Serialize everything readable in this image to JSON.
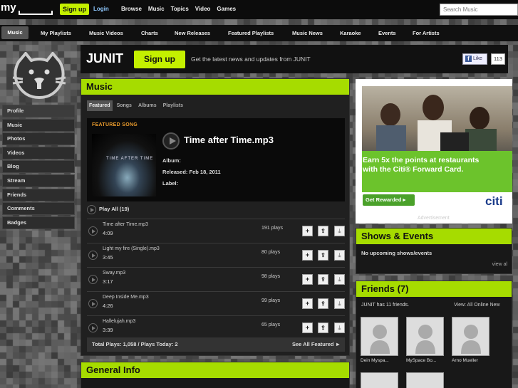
{
  "topbar": {
    "logo_text": "my",
    "signup_label": "Sign up",
    "login_label": "Login",
    "nav": [
      "Browse",
      "Music",
      "Topics",
      "Video",
      "Games"
    ],
    "search_placeholder": "Search Music"
  },
  "subnav": {
    "items": [
      "Music",
      "My Playlists",
      "Music Videos",
      "Charts",
      "New Releases",
      "Featured Playlists",
      "Music News",
      "Karaoke",
      "Events",
      "For Artists"
    ]
  },
  "sidebar": {
    "items": [
      "Profile",
      "Music",
      "Photos",
      "Videos",
      "Blog",
      "Stream",
      "Friends",
      "Comments",
      "Badges"
    ]
  },
  "header": {
    "artist_name": "JUNIT",
    "signup_label": "Sign up",
    "tagline": "Get the latest news and updates from JUNIT",
    "like_label": "Like",
    "like_count": "113"
  },
  "music": {
    "title": "Music",
    "tabs": [
      "Featured",
      "Songs",
      "Albums",
      "Playlists"
    ],
    "featured": {
      "label": "FEATURED SONG",
      "art_text": "TIME AFTER TIME",
      "song_title": "Time after Time.mp3",
      "album_label": "Album:",
      "released_label": "Released: Feb 18, 2011",
      "label_label": "Label:"
    },
    "play_all": "Play All (19)",
    "songs": [
      {
        "name": "Time after Time.mp3",
        "duration": "4:09",
        "plays": "191 plays"
      },
      {
        "name": "Light my fire (Single).mp3",
        "duration": "3:45",
        "plays": "80 plays"
      },
      {
        "name": "Sway.mp3",
        "duration": "3:17",
        "plays": "98 plays"
      },
      {
        "name": "Deep Inside Me.mp3",
        "duration": "4:26",
        "plays": "99 plays"
      },
      {
        "name": "Hallelujah.mp3",
        "duration": "3:39",
        "plays": "65 plays"
      }
    ],
    "totals": "Total Plays: 1,058 / Plays Today: 2",
    "see_all": "See All Featured ►"
  },
  "general_info": {
    "title": "General Info"
  },
  "ad": {
    "headline_1": "Earn 5x the points at restaurants",
    "headline_2": "with the Citi® Forward Card.",
    "cta": "Get Rewarded ▸",
    "brand": "citi",
    "caption": "Advertisement"
  },
  "shows": {
    "title": "Shows & Events",
    "empty": "No upcoming shows/events",
    "view_all": "view al"
  },
  "friends": {
    "title": "Friends (7)",
    "count_text": "JUNIT has 11 friends.",
    "view_text": "View:  All  Online  New",
    "names": [
      "Dein Myspa...",
      "MySpace Bo...",
      "Arno Mueller"
    ]
  },
  "colors": {
    "accent": "#a6dc00",
    "signup": "#c4f000",
    "featured_label": "#e89a2c",
    "citi_blue": "#1a3b8a",
    "ad_green": "#6cc32c"
  }
}
